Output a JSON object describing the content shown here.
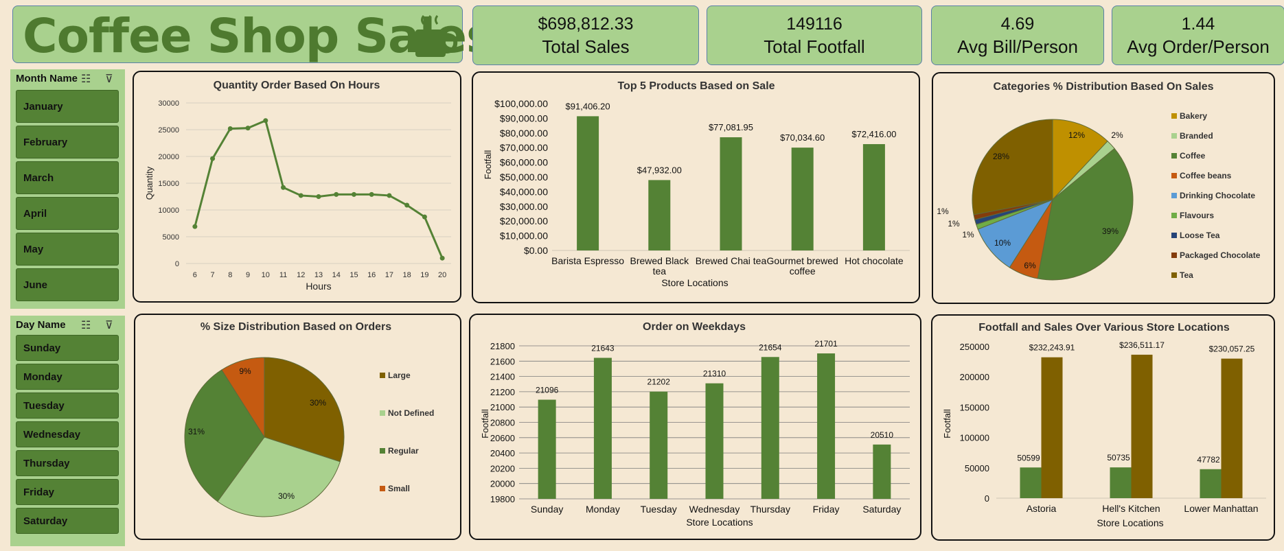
{
  "header": {
    "title": "Coffee Shop Sales"
  },
  "kpis": [
    {
      "value": "$698,812.33",
      "label": "Total Sales"
    },
    {
      "value": "149116",
      "label": "Total Footfall"
    },
    {
      "value": "4.69",
      "label": "Avg Bill/Person"
    },
    {
      "value": "1.44",
      "label": "Avg Order/Person"
    }
  ],
  "slicers": {
    "month": {
      "header": "Month Name",
      "items": [
        "January",
        "February",
        "March",
        "April",
        "May",
        "June"
      ]
    },
    "day": {
      "header": "Day Name",
      "items": [
        "Sunday",
        "Monday",
        "Tuesday",
        "Wednesday",
        "Thursday",
        "Friday",
        "Saturday"
      ]
    }
  },
  "colors": {
    "green": "#548235",
    "brown": "#7f6000",
    "light_green": "#a9d18e",
    "orange": "#c55a11",
    "background": "#f5e8d3"
  },
  "chart_data": [
    {
      "id": "hours",
      "type": "line",
      "title": "Quantity Order Based On Hours",
      "xlabel": "Hours",
      "ylabel": "Quantity",
      "x": [
        6,
        7,
        8,
        9,
        10,
        11,
        12,
        13,
        14,
        15,
        16,
        17,
        18,
        19,
        20
      ],
      "values": [
        6900,
        19600,
        25200,
        25300,
        26700,
        14200,
        12700,
        12500,
        12900,
        12900,
        12900,
        12700,
        10900,
        8700,
        1000
      ],
      "ylim": [
        0,
        30000
      ],
      "yticks": [
        0,
        5000,
        10000,
        15000,
        20000,
        25000,
        30000
      ],
      "grid": true
    },
    {
      "id": "products",
      "type": "bar",
      "title": "Top 5 Products Based on Sale",
      "xlabel": "Store Locations",
      "ylabel": "Footfall",
      "categories": [
        "Barista Espresso",
        "Brewed Black tea",
        "Brewed Chai tea",
        "Gourmet brewed coffee",
        "Hot chocolate"
      ],
      "values": [
        91406.2,
        47932.0,
        77081.95,
        70034.6,
        72416.0
      ],
      "value_labels": [
        "$91,406.20",
        "$47,932.00",
        "$77,081.95",
        "$70,034.60",
        "$72,416.00"
      ],
      "ylim": [
        0,
        100000
      ],
      "ytick_labels": [
        "$0.00",
        "$10,000.00",
        "$20,000.00",
        "$30,000.00",
        "$40,000.00",
        "$50,000.00",
        "$60,000.00",
        "$70,000.00",
        "$80,000.00",
        "$90,000.00",
        "$100,000.00"
      ],
      "grid": false
    },
    {
      "id": "categories",
      "type": "pie",
      "title": "Categories % Distribution Based On Sales",
      "legend": "right",
      "labels": [
        "Bakery",
        "Branded",
        "Coffee",
        "Coffee beans",
        "Drinking Chocolate",
        "Flavours",
        "Loose Tea",
        "Packaged Chocolate",
        "Tea"
      ],
      "values": [
        12,
        2,
        39,
        6,
        10,
        1,
        1,
        1,
        28
      ],
      "value_labels": [
        "12%",
        "2%",
        "39%",
        "6%",
        "10%",
        "1%",
        "1%",
        "1%",
        "28%"
      ],
      "colors": [
        "#bf9000",
        "#a9d18e",
        "#548235",
        "#c55a11",
        "#5b9bd5",
        "#70ad47",
        "#264478",
        "#843c0c",
        "#7f6000"
      ]
    },
    {
      "id": "sizes",
      "type": "pie",
      "title": "% Size Distribution Based on Orders",
      "legend": "right",
      "labels": [
        "Large",
        "Not Defined",
        "Regular",
        "Small"
      ],
      "values": [
        30,
        30,
        31,
        9
      ],
      "value_labels": [
        "30%",
        "30%",
        "31%",
        "9%"
      ],
      "colors": [
        "#7f6000",
        "#a9d18e",
        "#548235",
        "#c55a11"
      ]
    },
    {
      "id": "weekdays",
      "type": "bar",
      "title": "Order on Weekdays",
      "xlabel": "Store Locations",
      "ylabel": "Footfall",
      "categories": [
        "Sunday",
        "Monday",
        "Tuesday",
        "Wednesday",
        "Thursday",
        "Friday",
        "Saturday"
      ],
      "values": [
        21096,
        21643,
        21202,
        21310,
        21654,
        21701,
        20510
      ],
      "ylim": [
        19800,
        21800
      ],
      "yticks": [
        19800,
        20000,
        20200,
        20400,
        20600,
        20800,
        21000,
        21200,
        21400,
        21600,
        21800
      ],
      "grid": true
    },
    {
      "id": "stores",
      "type": "bar",
      "title": "Footfall and Sales Over Various Store Locations",
      "xlabel": "Store Locations",
      "ylabel": "Footfall",
      "categories": [
        "Astoria",
        "Hell's Kitchen",
        "Lower Manhattan"
      ],
      "series": [
        {
          "values": [
            50599,
            50735,
            47782
          ],
          "value_labels": [
            "50599",
            "50735",
            "47782"
          ],
          "color": "#548235"
        },
        {
          "values": [
            232243.91,
            236511.17,
            230057.25
          ],
          "value_labels": [
            "$232,243.91",
            "$236,511.17",
            "$230,057.25"
          ],
          "color": "#7f6000"
        }
      ],
      "ylim": [
        0,
        250000
      ],
      "yticks": [
        0,
        50000,
        100000,
        150000,
        200000,
        250000
      ],
      "grid": false
    }
  ]
}
